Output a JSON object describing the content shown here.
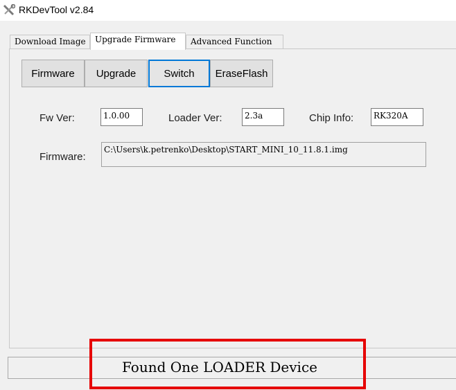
{
  "window": {
    "title": "RKDevTool v2.84"
  },
  "tabs": [
    {
      "label": "Download Image"
    },
    {
      "label": "Upgrade Firmware"
    },
    {
      "label": "Advanced Function"
    }
  ],
  "toolbar": {
    "firmware_label": "Firmware",
    "upgrade_label": "Upgrade",
    "switch_label": "Switch",
    "eraseflash_label": "EraseFlash"
  },
  "info": {
    "fw_ver_label": "Fw Ver:",
    "fw_ver_value": "1.0.00",
    "loader_ver_label": "Loader Ver:",
    "loader_ver_value": "2.3a",
    "chip_info_label": "Chip Info:",
    "chip_info_value": "RK320A",
    "firmware_label": "Firmware:",
    "firmware_path": "C:\\Users\\k.petrenko\\Desktop\\START_MINI_10_11.8.1.img"
  },
  "status": {
    "text": "Found One LOADER Device"
  },
  "colors": {
    "highlight": "#e60000",
    "focus": "#0078d7"
  }
}
